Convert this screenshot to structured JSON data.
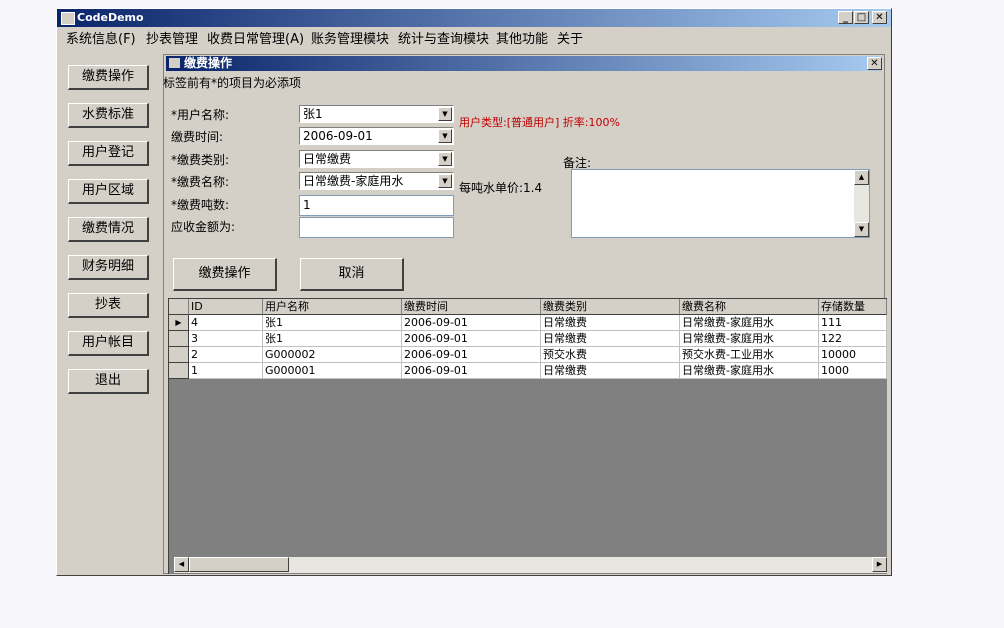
{
  "window": {
    "title": "CodeDemo"
  },
  "menu": [
    "系统信息(F)",
    "抄表管理",
    "收费日常管理(A)",
    "账务管理模块",
    "统计与查询模块",
    "其他功能",
    "关于"
  ],
  "sidebar": [
    "缴费操作",
    "水费标准",
    "用户登记",
    "用户区域",
    "缴费情况",
    "财务明细",
    "抄表",
    "用户帐目",
    "退出"
  ],
  "child": {
    "title": "缴费操作",
    "hint": "标签前有*的项目为必添项",
    "labels": {
      "user_name": "*用户名称:",
      "pay_time": "缴费时间:",
      "pay_type": "*缴费类别:",
      "pay_name": "*缴费名称:",
      "tons": "*缴费吨数:",
      "amount": "应收金额为:",
      "remark": "备注:"
    },
    "values": {
      "user_name": "张1",
      "pay_time": "2006-09-01",
      "pay_type": "日常缴费",
      "pay_name": "日常缴费-家庭用水",
      "tons": "1",
      "amount": ""
    },
    "user_type": "用户类型:[普通用户] 折率:100%",
    "unit_price": "每吨水单价:1.4",
    "buttons": {
      "submit": "缴费操作",
      "cancel": "取消"
    }
  },
  "grid": {
    "columns": [
      "ID",
      "用户名称",
      "缴费时间",
      "缴费类别",
      "缴费名称",
      "存储数量"
    ],
    "rows": [
      [
        "4",
        "张1",
        "2006-09-01",
        "日常缴费",
        "日常缴费-家庭用水",
        "111"
      ],
      [
        "3",
        "张1",
        "2006-09-01",
        "日常缴费",
        "日常缴费-家庭用水",
        "122"
      ],
      [
        "2",
        "G000002",
        "2006-09-01",
        "预交水费",
        "预交水费-工业用水",
        "10000"
      ],
      [
        "1",
        "G000001",
        "2006-09-01",
        "日常缴费",
        "日常缴费-家庭用水",
        "1000"
      ]
    ],
    "current_row_marker": "▶"
  },
  "colors": {
    "title_start": "#0a246a",
    "title_end": "#a6caf0",
    "user_type_text": "#c00000",
    "face": "#d4d0c8"
  }
}
